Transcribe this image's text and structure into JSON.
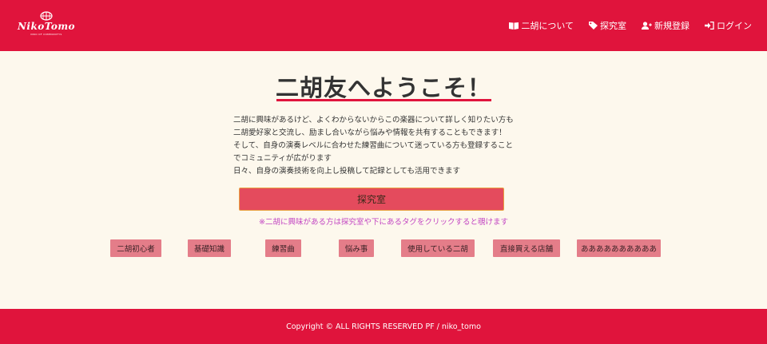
{
  "header": {
    "logo_text": "NikoTomo",
    "logo_sub": "NIKO OF COMMUNITYS",
    "nav": [
      {
        "label": "二胡について",
        "icon": "book-icon"
      },
      {
        "label": "探究室",
        "icon": "tag-icon"
      },
      {
        "label": "新規登録",
        "icon": "user-plus-icon"
      },
      {
        "label": "ログイン",
        "icon": "sign-in-icon"
      }
    ]
  },
  "main": {
    "title": "二胡友へようこそ！",
    "intro": [
      "二胡に興味があるけど、よくわからないからこの楽器について詳しく知りたい方も",
      "二胡愛好家と交流し、励まし合いながら悩みや情報を共有することもできます！",
      "そして、自身の演奏レベルに合わせた練習曲について迷っている方も登録すること",
      "でコミュニティが広がります",
      "日々、自身の演奏技術を向上し投稿して記録としても活用できます"
    ],
    "explore_button": "探究室",
    "note": "※二胡に興味がある方は探究室や下にあるタグをクリックすると覗けます",
    "tags": [
      "二胡初心者",
      "基礎知識",
      "練習曲",
      "悩み事",
      "使用している二胡",
      "直接買える店舗",
      "ああああああああああ"
    ]
  },
  "footer": {
    "copyright": "Copyright © ALL RIGHTS RESERVED PF / niko_tomo"
  },
  "colors": {
    "brand_red": "#e0143c",
    "background": "#fdf8ed",
    "button": "#e44b5d",
    "tag": "#e47d89",
    "note": "#c244c2"
  }
}
